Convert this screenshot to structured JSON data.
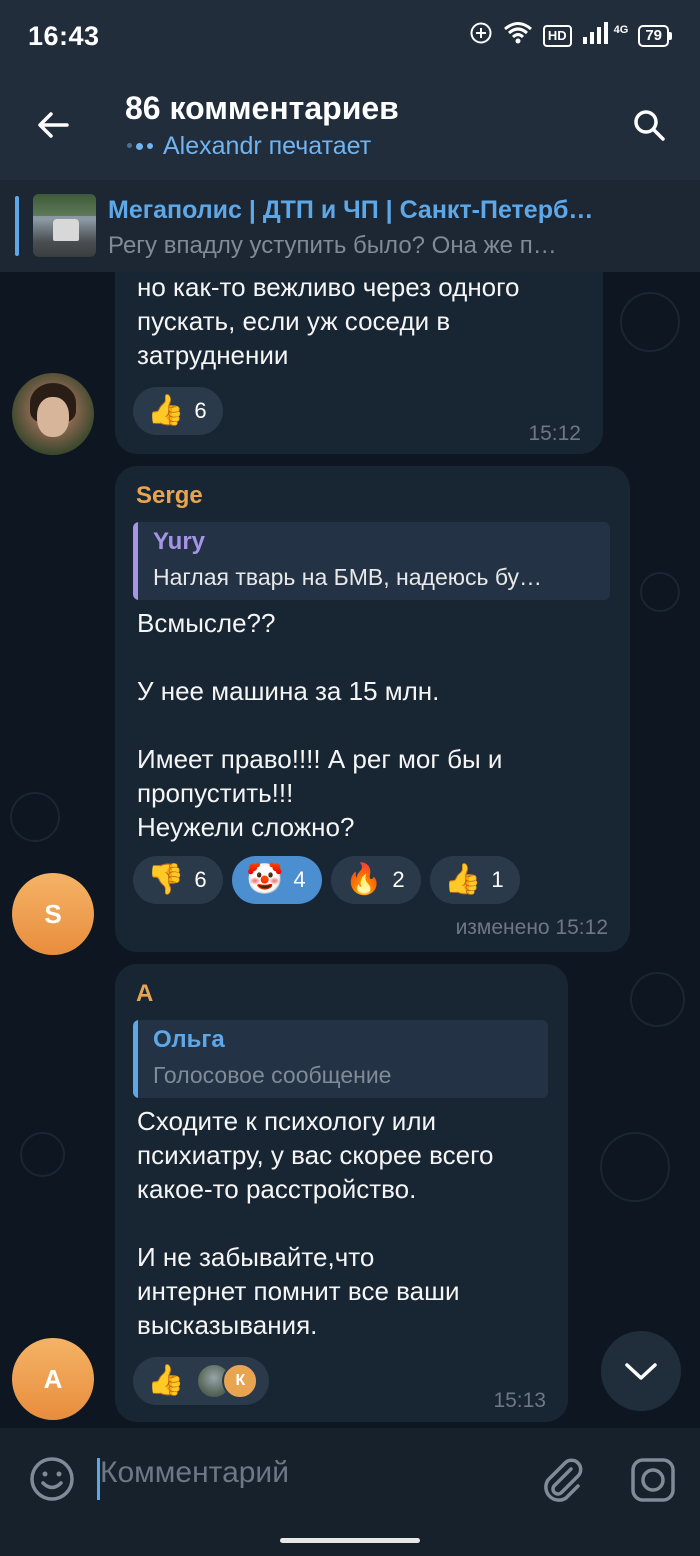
{
  "status_bar": {
    "time": "16:43",
    "network": "4G",
    "hd": "HD",
    "battery": "79"
  },
  "header": {
    "title": "86 комментариев",
    "typing_user": "Alexandr печатает"
  },
  "pinned": {
    "title": "Мегаполис | ДТП и ЧП | Санкт-Петерб…",
    "text": "Регу впадлу уступить было? Она же п…"
  },
  "messages": [
    {
      "text_lines": [
        "но как-то вежливо через одного",
        "пускать, если уж соседи в",
        "затруднении"
      ],
      "reactions": [
        {
          "emoji": "👍",
          "count": "6"
        }
      ],
      "time": "15:12"
    },
    {
      "sender": "Serge",
      "sender_initial": "S",
      "reply": {
        "name": "Yury",
        "text": "Наглая тварь на БМВ, надеюсь бу…"
      },
      "text_lines": [
        "Всмысле??",
        "",
        "У нее машина за 15 млн.",
        "",
        "Имеет право!!!! А рег мог бы и",
        "пропустить!!!",
        "Неужели сложно?"
      ],
      "reactions": [
        {
          "emoji": "👎",
          "count": "6"
        },
        {
          "emoji": "🤡",
          "count": "4"
        },
        {
          "emoji": "🔥",
          "count": "2"
        },
        {
          "emoji": "👍",
          "count": "1"
        }
      ],
      "time": "изменено 15:12"
    },
    {
      "sender": "A",
      "sender_initial": "A",
      "reply": {
        "name": "Ольга",
        "text": "Голосовое сообщение"
      },
      "text_lines": [
        "Сходите к психологу или",
        "психиатру, у вас скорее всего",
        "какое-то расстройство.",
        "",
        "И не забывайте,что",
        "интернет помнит все ваши",
        "высказывания."
      ],
      "reactions": [
        {
          "emoji": "👍",
          "reactor_initial": "К"
        }
      ],
      "time": "15:13"
    }
  ],
  "input": {
    "placeholder": "Комментарий"
  },
  "colors": {
    "accent": "#5ea8e8",
    "serge_name": "#e9a451",
    "a_name": "#e9a451",
    "yury_name": "#a695e7",
    "olga_name": "#5ea8e8",
    "bubble": "#182533",
    "background": "#0e1621"
  },
  "icons": [
    "back-arrow-icon",
    "search-icon",
    "emoji-icon",
    "paperclip-icon",
    "camera-icon",
    "chevron-down-icon"
  ]
}
